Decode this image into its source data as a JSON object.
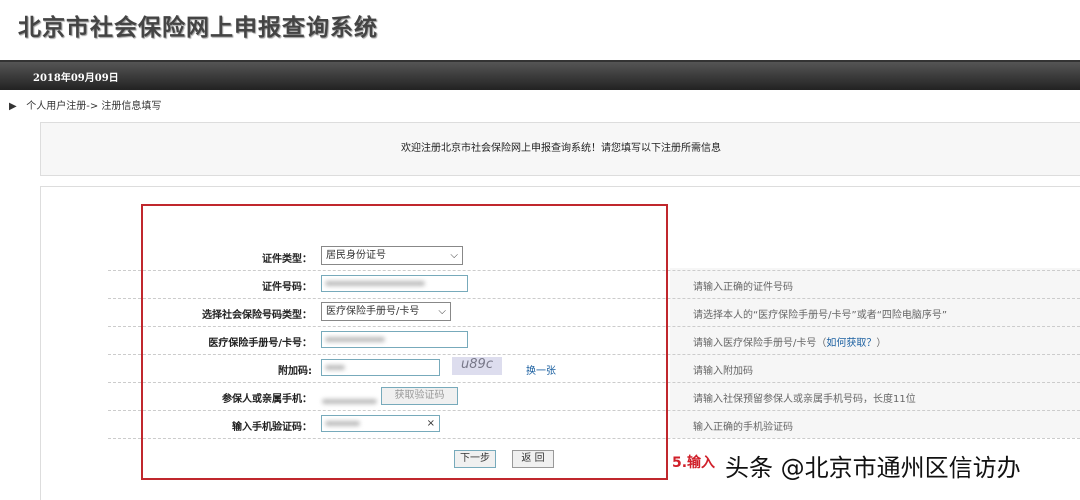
{
  "title": "北京市社会保险网上申报查询系统",
  "date": "2018年09月09日",
  "breadcrumb": "个人用户注册-> 注册信息填写",
  "welcome": "欢迎注册北京市社会保险网上申报查询系统！请您填写以下注册所需信息",
  "form": {
    "id_type": {
      "label": "证件类型：",
      "value": "居民身份证号"
    },
    "id_no": {
      "label": "证件号码：",
      "help": "请输入正确的证件号码"
    },
    "ins_type": {
      "label": "选择社会保险号码类型：",
      "value": "医疗保险手册号/卡号",
      "help": "请选择本人的“医疗保险手册号/卡号”或者“四险电脑序号”"
    },
    "card_no": {
      "label": "医疗保险手册号/卡号：",
      "help": "请输入医疗保险手册号/卡号（",
      "help_link": "如何获取？",
      "help_end": "）"
    },
    "captcha": {
      "label": "附加码:",
      "image_text": "u89c",
      "refresh": "换一张",
      "help": "请输入附加码"
    },
    "phone": {
      "label": "参保人或亲属手机：",
      "button": "获取验证码",
      "help": "请输入社保预留参保人或亲属手机号码，长度11位"
    },
    "sms": {
      "label": "输入手机验证码：",
      "clear": "×",
      "help": "输入正确的手机验证码"
    },
    "next": "下一步",
    "back": "返 回"
  },
  "annotation": "5.输入",
  "watermark": "头条 @北京市通州区信访办",
  "colors": {
    "highlight": "#c0272d"
  }
}
